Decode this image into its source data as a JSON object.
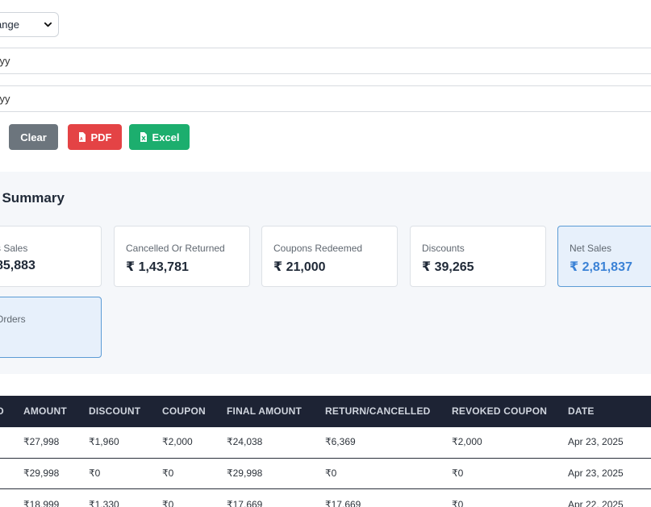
{
  "filters": {
    "range_select": "ange",
    "date_from": "yyy",
    "date_to": "yyy"
  },
  "buttons": {
    "clear": "Clear",
    "pdf": "PDF",
    "excel": "Excel"
  },
  "summary": {
    "title": "Summary",
    "cards": [
      {
        "label": "s Sales",
        "value": "85,883"
      },
      {
        "label": "Cancelled Or Returned",
        "value": "₹ 1,43,781"
      },
      {
        "label": "Coupons Redeemed",
        "value": "₹ 21,000"
      },
      {
        "label": "Discounts",
        "value": "₹ 39,265"
      },
      {
        "label": "Net Sales",
        "value": "₹ 2,81,837"
      },
      {
        "label": "Orders",
        "value": ""
      }
    ]
  },
  "table": {
    "columns": [
      "D",
      "AMOUNT",
      "DISCOUNT",
      "COUPON",
      "FINAL AMOUNT",
      "RETURN/CANCELLED",
      "REVOKED COUPON",
      "DATE"
    ],
    "rows": [
      {
        "amount": "₹27,998",
        "discount": "₹1,960",
        "coupon": "₹2,000",
        "final": "₹24,038",
        "returned": "₹6,369",
        "revoked": "₹2,000",
        "date": "Apr 23, 2025"
      },
      {
        "amount": "₹29,998",
        "discount": "₹0",
        "coupon": "₹0",
        "final": "₹29,998",
        "returned": "₹0",
        "revoked": "₹0",
        "date": "Apr 23, 2025"
      },
      {
        "amount": "₹18,999",
        "discount": "₹1,330",
        "coupon": "₹0",
        "final": "₹17,669",
        "returned": "₹17,669",
        "revoked": "₹0",
        "date": "Apr 22, 2025"
      }
    ]
  },
  "colors": {
    "clear": "#6c757d",
    "pdf": "#e44345",
    "excel": "#1cae6e",
    "table_header": "#1d2334",
    "net_sales_accent": "#3b82d6"
  }
}
